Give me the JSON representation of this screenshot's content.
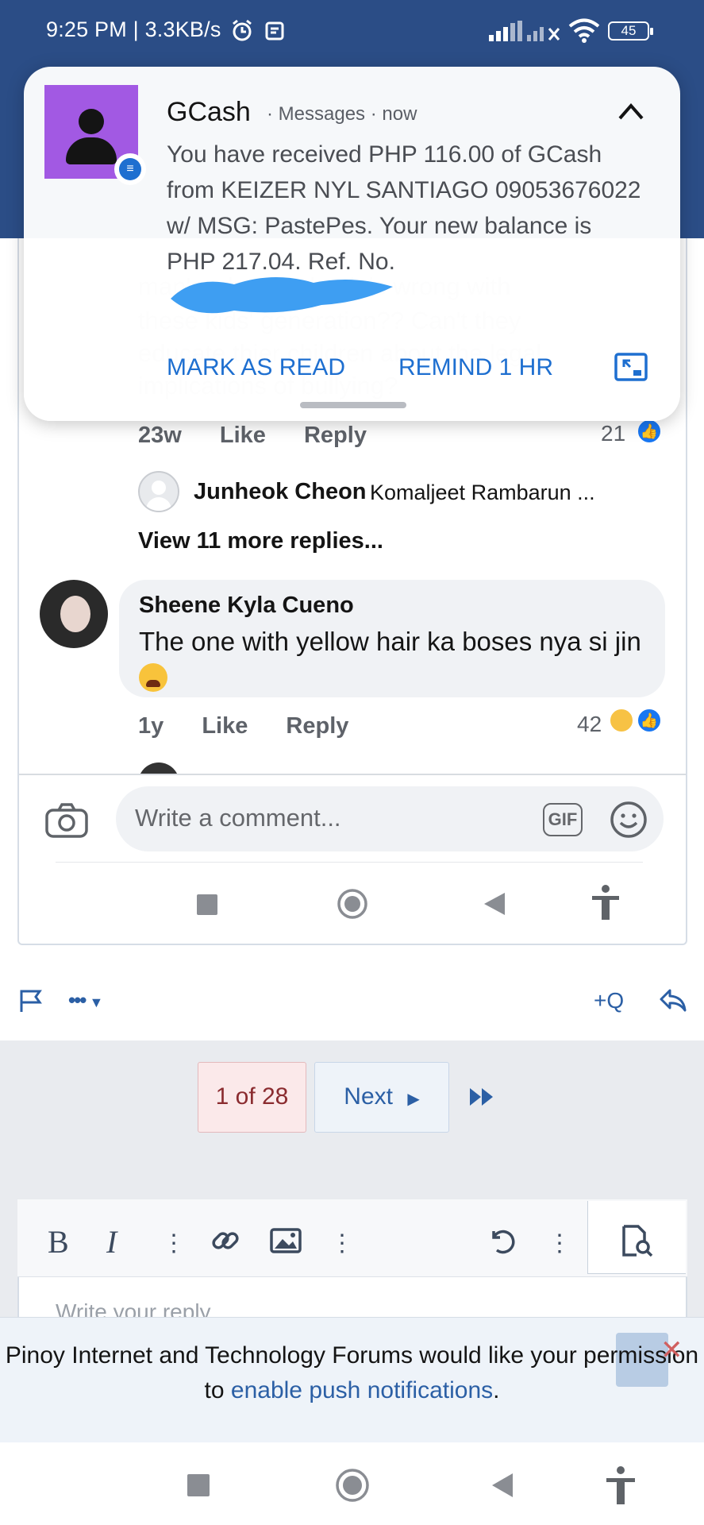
{
  "status_bar": {
    "time_speed": "9:25 PM | 3.3KB/s",
    "battery": "45"
  },
  "notification": {
    "app": "GCash",
    "source": "Messages",
    "when": "now",
    "body": "You have received PHP 116.00 of GCash from KEIZER NYL SANTIAGO 09053676022 w/ MSG: PastePes. Your new balance is PHP 217.04. Ref. No.",
    "mark_as_read": "MARK AS READ",
    "remind": "REMIND 1 HR"
  },
  "comments": {
    "first": {
      "age": "23w",
      "like": "Like",
      "reply": "Reply",
      "reactions": "21"
    },
    "nested_reply": {
      "name": "Junheok Cheon",
      "text": "Komaljeet Rambarun ..."
    },
    "view_more": "View 11 more replies...",
    "second": {
      "name": "Sheene Kyla Cueno",
      "text": "The one with yellow hair ka boses nya si jin",
      "age": "1y",
      "like": "Like",
      "reply": "Reply",
      "reactions": "42"
    }
  },
  "composer": {
    "placeholder": "Write a comment...",
    "gif": "GIF"
  },
  "actions": {
    "more": "•••",
    "quote": "+Q"
  },
  "pagination": {
    "current": "1 of 28",
    "next": "Next"
  },
  "editor": {
    "placeholder": "Write your reply..."
  },
  "push_banner": {
    "text_before": "Pinoy Internet and Technology Forums would like your permission to ",
    "link": "enable push notifications",
    "text_after": "."
  },
  "colors": {
    "header": "#2b4d86",
    "link": "#2b5fa5",
    "notif_accent": "#1e6fd0"
  }
}
